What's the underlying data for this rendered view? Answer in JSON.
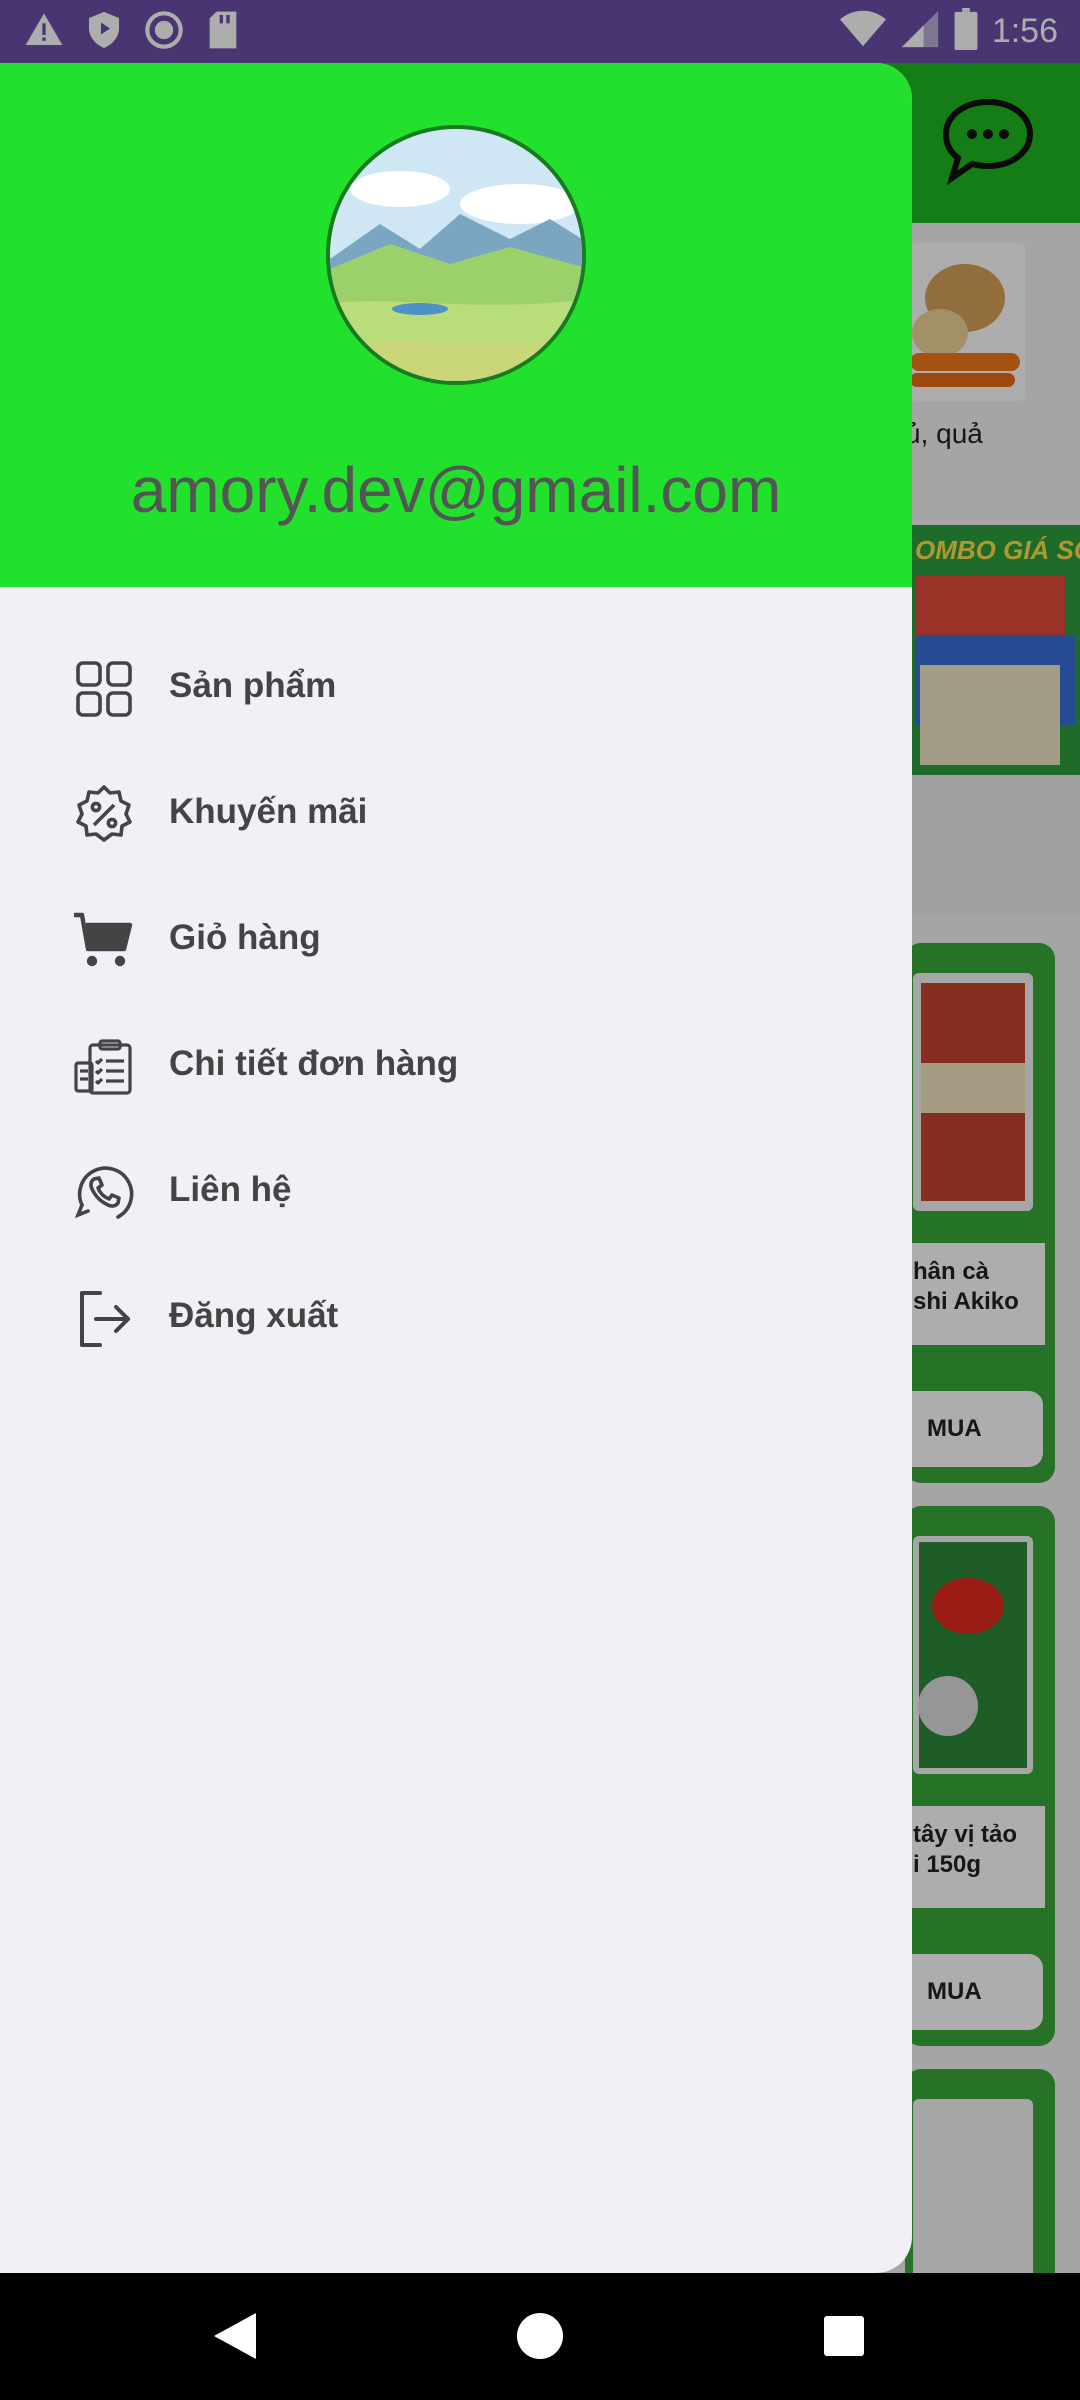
{
  "status_bar": {
    "time": "1:56",
    "left_icons": [
      "warning-icon",
      "shield-icon",
      "record-icon",
      "sd-card-icon"
    ],
    "right_icons": [
      "wifi-icon",
      "signal-icon",
      "battery-icon"
    ]
  },
  "drawer": {
    "header": {
      "email": "amory.dev@gmail.com",
      "avatar": "landscape-avatar"
    },
    "menu": [
      {
        "label": "Sản phẩm",
        "icon": "grid-icon"
      },
      {
        "label": "Khuyến mãi",
        "icon": "discount-badge-icon"
      },
      {
        "label": "Giỏ hàng",
        "icon": "cart-icon"
      },
      {
        "label": "Chi tiết đơn hàng",
        "icon": "order-clipboard-icon"
      },
      {
        "label": "Liên hệ",
        "icon": "phone-icon"
      },
      {
        "label": "Đăng xuất",
        "icon": "logout-icon"
      }
    ]
  },
  "background": {
    "category_text": "ủ, quả",
    "banner_text": "OMBO GIÁ SỐC",
    "products": [
      {
        "name_line1": "hân cà",
        "name_line2": "shi Akiko",
        "buy": "MUA"
      },
      {
        "name_line1": "tây vị tảo",
        "name_line2": "i 150g",
        "buy": "MUA"
      }
    ]
  },
  "colors": {
    "header_green": "#21e12d",
    "status_purple": "#6b4fa8",
    "drawer_bg": "#f3eff7",
    "label_text": "#444444"
  },
  "nav_bar": {
    "buttons": [
      "back-button",
      "home-button",
      "recents-button"
    ]
  }
}
